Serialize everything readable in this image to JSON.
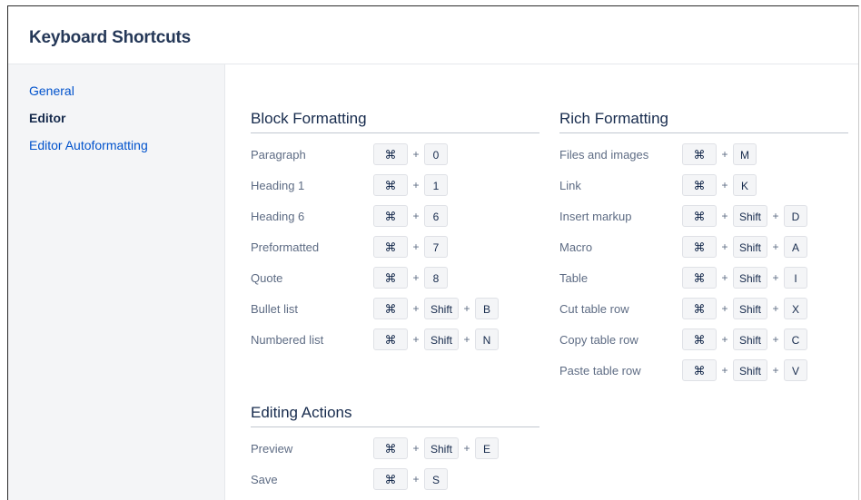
{
  "dialog": {
    "title": "Keyboard Shortcuts"
  },
  "sidebar": {
    "items": [
      {
        "label": "General",
        "active": false
      },
      {
        "label": "Editor",
        "active": true
      },
      {
        "label": "Editor Autoformatting",
        "active": false
      }
    ]
  },
  "sections": {
    "block": {
      "title": "Block Formatting",
      "rows": [
        {
          "label": "Paragraph",
          "keys": [
            "⌘",
            "0"
          ]
        },
        {
          "label": "Heading 1",
          "keys": [
            "⌘",
            "1"
          ]
        },
        {
          "label": "Heading 6",
          "keys": [
            "⌘",
            "6"
          ]
        },
        {
          "label": "Preformatted",
          "keys": [
            "⌘",
            "7"
          ]
        },
        {
          "label": "Quote",
          "keys": [
            "⌘",
            "8"
          ]
        },
        {
          "label": "Bullet list",
          "keys": [
            "⌘",
            "Shift",
            "B"
          ]
        },
        {
          "label": "Numbered list",
          "keys": [
            "⌘",
            "Shift",
            "N"
          ]
        }
      ]
    },
    "rich": {
      "title": "Rich Formatting",
      "rows": [
        {
          "label": "Files and images",
          "keys": [
            "⌘",
            "M"
          ]
        },
        {
          "label": "Link",
          "keys": [
            "⌘",
            "K"
          ]
        },
        {
          "label": "Insert markup",
          "keys": [
            "⌘",
            "Shift",
            "D"
          ]
        },
        {
          "label": "Macro",
          "keys": [
            "⌘",
            "Shift",
            "A"
          ]
        },
        {
          "label": "Table",
          "keys": [
            "⌘",
            "Shift",
            "I"
          ]
        },
        {
          "label": "Cut table row",
          "keys": [
            "⌘",
            "Shift",
            "X"
          ]
        },
        {
          "label": "Copy table row",
          "keys": [
            "⌘",
            "Shift",
            "C"
          ]
        },
        {
          "label": "Paste table row",
          "keys": [
            "⌘",
            "Shift",
            "V"
          ]
        }
      ]
    },
    "editing": {
      "title": "Editing Actions",
      "rows": [
        {
          "label": "Preview",
          "keys": [
            "⌘",
            "Shift",
            "E"
          ]
        },
        {
          "label": "Save",
          "keys": [
            "⌘",
            "S"
          ]
        }
      ]
    }
  },
  "plus_symbol": "+"
}
